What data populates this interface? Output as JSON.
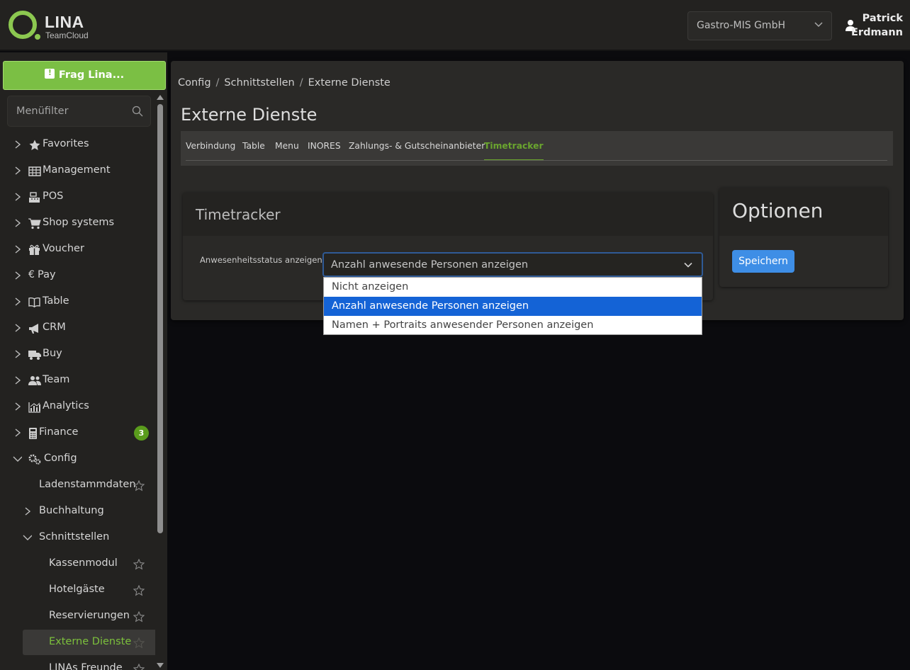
{
  "brand": {
    "name": "LINA",
    "sub": "TeamCloud",
    "accent": "#8cc850"
  },
  "header": {
    "company": "Gastro-MIS GmbH",
    "user_first": "Patrick",
    "user_last": "Erdmann"
  },
  "sidebar": {
    "ask_button": "Frag Lina...",
    "filter_placeholder": "Menüfilter",
    "items": [
      {
        "label": "Favorites",
        "icon": "star-icon"
      },
      {
        "label": "Management",
        "icon": "table-icon"
      },
      {
        "label": "POS",
        "icon": "cash-register-icon"
      },
      {
        "label": "Shop systems",
        "icon": "cart-icon"
      },
      {
        "label": "Voucher",
        "icon": "gift-icon"
      },
      {
        "label": "Pay",
        "icon": "euro-icon"
      },
      {
        "label": "Table",
        "icon": "book-icon"
      },
      {
        "label": "CRM",
        "icon": "megaphone-icon"
      },
      {
        "label": "Buy",
        "icon": "truck-icon"
      },
      {
        "label": "Team",
        "icon": "users-icon"
      },
      {
        "label": "Analytics",
        "icon": "chart-icon"
      },
      {
        "label": "Finance",
        "icon": "calculator-icon",
        "badge": "3"
      },
      {
        "label": "Config",
        "icon": "gears-icon"
      }
    ],
    "config_children": {
      "ladenstammdaten": "Ladenstammdaten",
      "buchhaltung": "Buchhaltung",
      "schnittstellen": "Schnittstellen"
    },
    "schnittstellen_children": [
      "Kassenmodul",
      "Hotelgäste",
      "Reservierungen",
      "Externe Dienste",
      "LINAs Freunde"
    ],
    "active_color": "#7cc03c"
  },
  "breadcrumb": [
    "Config",
    "Schnittstellen",
    "Externe Dienste"
  ],
  "page_title": "Externe Dienste",
  "tabs": [
    "Verbindung",
    "Table",
    "Menu",
    "INORES",
    "Zahlungs- & Gutscheinanbieter",
    "Timetracker"
  ],
  "active_tab": "Timetracker",
  "timetracker": {
    "title": "Timetracker",
    "field_label": "Anwesenheitsstatus anzeigen",
    "selected_value": "Anzahl anwesende Personen anzeigen",
    "options": [
      "Nicht anzeigen",
      "Anzahl anwesende Personen anzeigen",
      "Namen + Portraits anwesender Personen anzeigen"
    ]
  },
  "options_panel": {
    "title": "Optionen",
    "save_label": "Speichern",
    "save_color": "#3e8ee6"
  }
}
